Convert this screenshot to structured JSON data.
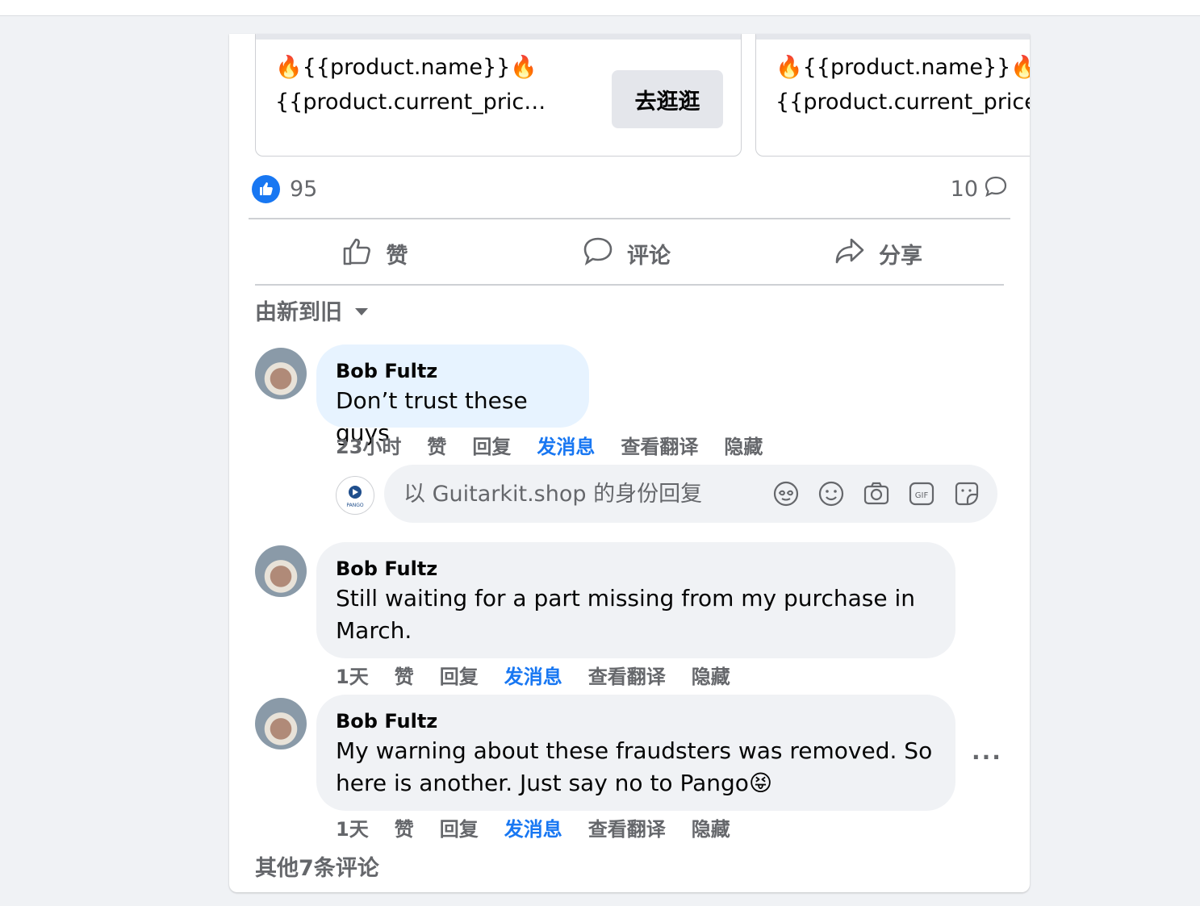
{
  "products": [
    {
      "name": "🔥{{product.name}}🔥",
      "price": "{{product.current_price}}",
      "button": "去逛逛"
    },
    {
      "name": "🔥{{product.name}}🔥",
      "price": "{{product.current_price}}"
    }
  ],
  "reactions": {
    "likes": "95",
    "comments": "10"
  },
  "actions": {
    "like": "赞",
    "comment": "评论",
    "share": "分享"
  },
  "sort": {
    "label": "由新到旧"
  },
  "comments": [
    {
      "author": "Bob Fultz",
      "text": "Don’t trust these guys",
      "time": "23小时",
      "like": "赞",
      "reply": "回复",
      "message": "发消息",
      "translate": "查看翻译",
      "hide": "隐藏"
    },
    {
      "author": "Bob Fultz",
      "text": "Still waiting for a part missing from my purchase in March.",
      "time": "1天",
      "like": "赞",
      "reply": "回复",
      "message": "发消息",
      "translate": "查看翻译",
      "hide": "隐藏"
    },
    {
      "author": "Bob Fultz",
      "text": "My warning about these fraudsters was removed. So here is another. Just say no to Pango😝",
      "time": "1天",
      "like": "赞",
      "reply": "回复",
      "message": "发消息",
      "translate": "查看翻译",
      "hide": "隐藏"
    }
  ],
  "reply": {
    "placeholder": "以 Guitarkit.shop 的身份回复",
    "page_logo_text": "PANGO"
  },
  "more_options": "···",
  "other_comments": "其他7条评论",
  "colors": {
    "accent": "#1877f2",
    "secondary_text": "#65676b",
    "bubble": "#f0f2f5",
    "bubble_highlight": "#e7f3ff"
  }
}
